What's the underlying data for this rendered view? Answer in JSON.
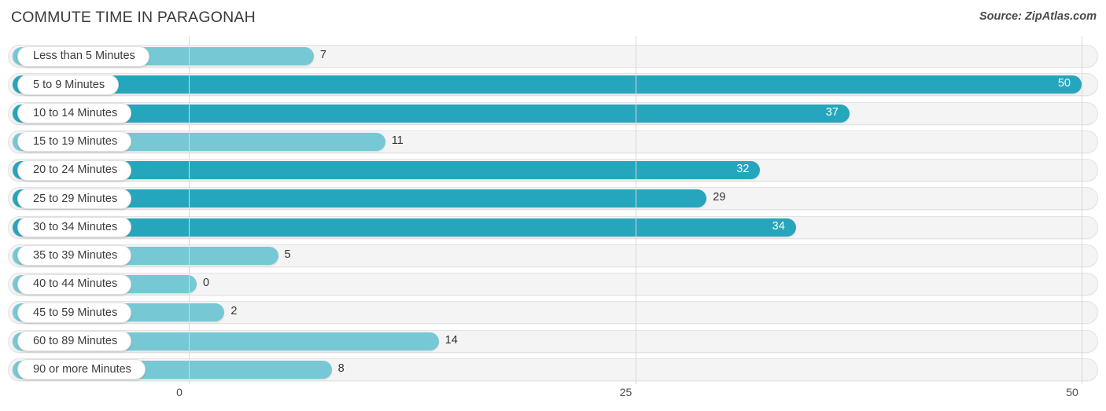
{
  "header": {
    "title": "COMMUTE TIME IN PARAGONAH",
    "source": "Source: ZipAtlas.com"
  },
  "colors": {
    "bar_light": "#76c8d4",
    "bar_dark": "#26a6bc",
    "track": "#f4f4f4",
    "track_border": "#e3e3e3",
    "gridline": "#d8d8d8",
    "text": "#3c3c3c",
    "value_inside": "#ffffff"
  },
  "axis": {
    "ticks": [
      {
        "label": "0",
        "value": 0
      },
      {
        "label": "25",
        "value": 25
      },
      {
        "label": "50",
        "value": 50
      }
    ],
    "min": 0,
    "max": 50
  },
  "chart_data": {
    "type": "bar",
    "orientation": "horizontal",
    "title": "COMMUTE TIME IN PARAGONAH",
    "subtitle": "",
    "xlabel": "",
    "ylabel": "",
    "xlim": [
      0,
      50
    ],
    "grid": true,
    "legend": false,
    "source": "Source: ZipAtlas.com",
    "categories": [
      "Less than 5 Minutes",
      "5 to 9 Minutes",
      "10 to 14 Minutes",
      "15 to 19 Minutes",
      "20 to 24 Minutes",
      "25 to 29 Minutes",
      "30 to 34 Minutes",
      "35 to 39 Minutes",
      "40 to 44 Minutes",
      "45 to 59 Minutes",
      "60 to 89 Minutes",
      "90 or more Minutes"
    ],
    "values": [
      7,
      50,
      37,
      11,
      32,
      29,
      34,
      5,
      0,
      2,
      14,
      8
    ],
    "value_labels": [
      "7",
      "50",
      "37",
      "11",
      "32",
      "29",
      "34",
      "5",
      "0",
      "2",
      "14",
      "8"
    ],
    "bars": [
      {
        "label": "Less than 5 Minutes",
        "value": 7,
        "value_label": "7",
        "shade": "light",
        "label_placement": "outside"
      },
      {
        "label": "5 to 9 Minutes",
        "value": 50,
        "value_label": "50",
        "shade": "dark",
        "label_placement": "inside"
      },
      {
        "label": "10 to 14 Minutes",
        "value": 37,
        "value_label": "37",
        "shade": "dark",
        "label_placement": "inside"
      },
      {
        "label": "15 to 19 Minutes",
        "value": 11,
        "value_label": "11",
        "shade": "light",
        "label_placement": "outside"
      },
      {
        "label": "20 to 24 Minutes",
        "value": 32,
        "value_label": "32",
        "shade": "dark",
        "label_placement": "inside"
      },
      {
        "label": "25 to 29 Minutes",
        "value": 29,
        "value_label": "29",
        "shade": "dark",
        "label_placement": "outside"
      },
      {
        "label": "30 to 34 Minutes",
        "value": 34,
        "value_label": "34",
        "shade": "dark",
        "label_placement": "inside"
      },
      {
        "label": "35 to 39 Minutes",
        "value": 5,
        "value_label": "5",
        "shade": "light",
        "label_placement": "outside"
      },
      {
        "label": "40 to 44 Minutes",
        "value": 0,
        "value_label": "0",
        "shade": "light",
        "label_placement": "outside"
      },
      {
        "label": "45 to 59 Minutes",
        "value": 2,
        "value_label": "2",
        "shade": "light",
        "label_placement": "outside"
      },
      {
        "label": "60 to 89 Minutes",
        "value": 14,
        "value_label": "14",
        "shade": "light",
        "label_placement": "outside"
      },
      {
        "label": "90 or more Minutes",
        "value": 8,
        "value_label": "8",
        "shade": "light",
        "label_placement": "outside"
      }
    ]
  }
}
